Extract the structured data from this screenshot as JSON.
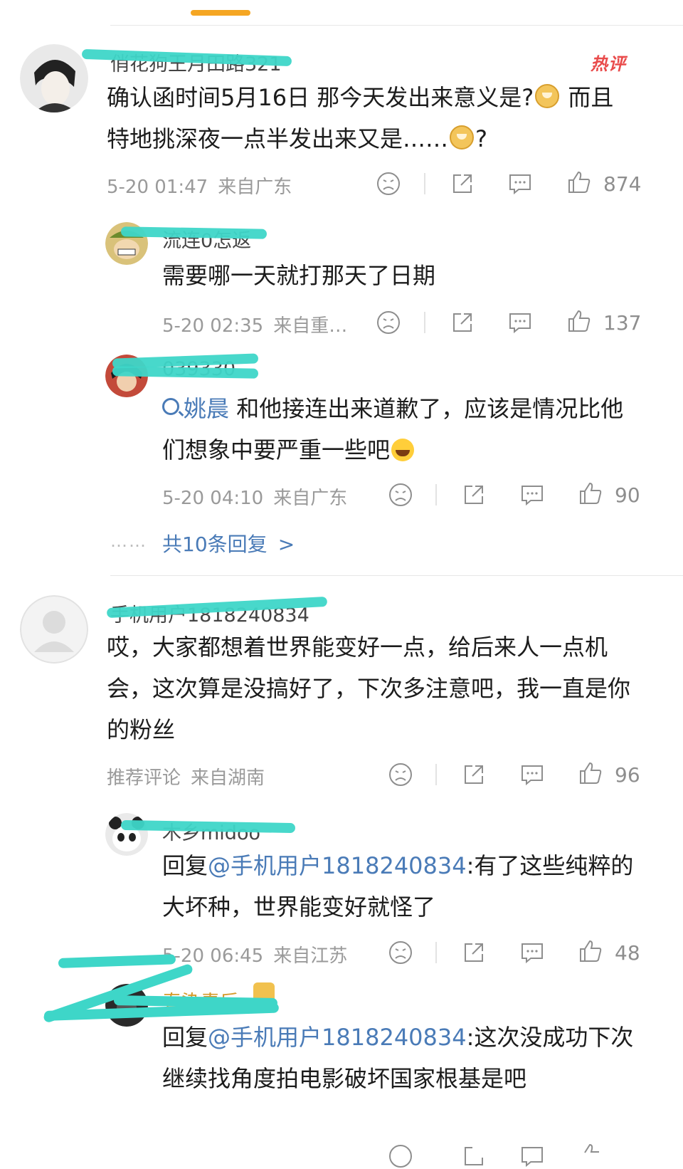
{
  "comments": [
    {
      "username": "俏花狗王月田路321",
      "badge": "热评",
      "text_parts": [
        "确认函时间5月16日 那今天发出来意义是?",
        "而且特地挑深夜一点半发出来又是……",
        "?"
      ],
      "time": "5-20 01:47",
      "location": "来自广东",
      "likes": "874"
    },
    {
      "username": "流连0怎返",
      "text": "需要哪一天就打那天了日期",
      "time": "5-20 02:35",
      "location": "来自重…",
      "likes": "137"
    },
    {
      "username": "039330",
      "mention": "姚晨",
      "text": " 和他接连出来道歉了，应该是情况比他们想象中要严重一些吧",
      "time": "5-20 04:10",
      "location": "来自广东",
      "likes": "90"
    },
    {
      "username": "手机用户1818240834",
      "text": "哎，大家都想着世界能变好一点，给后来人一点机会，这次算是没搞好了，下次多注意吧，我一直是你的粉丝",
      "time": "推荐评论",
      "location": "来自湖南",
      "likes": "96"
    },
    {
      "username": "木乡midoo",
      "reply_prefix": "回复",
      "mention": "@手机用户1818240834",
      "text": ":有了这些纯粹的大坏种，世界能变好就怪了",
      "time": "5-20 06:45",
      "location": "来自江苏",
      "likes": "48"
    },
    {
      "username": "春染青后",
      "reply_prefix": "回复",
      "mention": "@手机用户1818240834",
      "text": ":这次没成功下次继续找角度拍电影破坏国家根基是吧"
    }
  ],
  "more_replies": {
    "dots": "……",
    "label": "共10条回复",
    "chevron": ">"
  },
  "icons": [
    "dislike-icon",
    "share-icon",
    "comment-icon",
    "like-icon"
  ],
  "colors": {
    "accent": "#f5a623",
    "link": "#4a7bb7",
    "hot": "#e94b4b",
    "redaction": "#3ed6c8"
  }
}
